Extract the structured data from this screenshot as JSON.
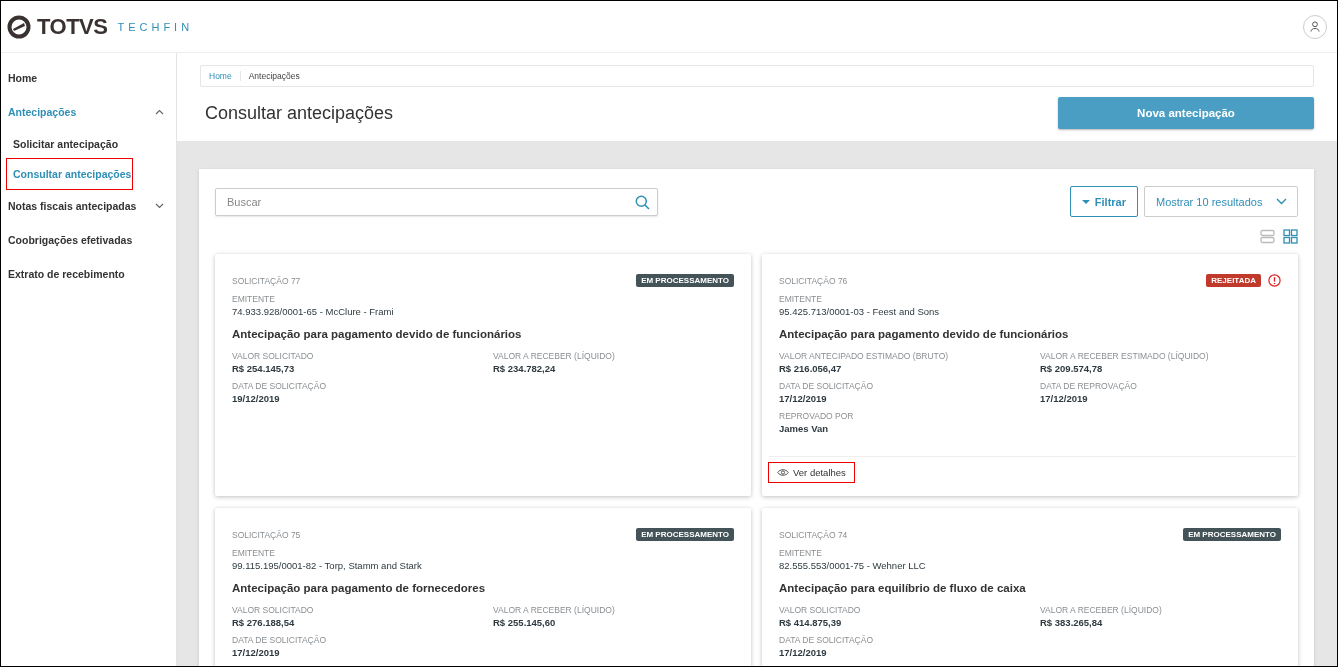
{
  "header": {
    "brand": "TOTVS",
    "brand_sub": "TECHFIN"
  },
  "sidebar": {
    "items": [
      {
        "label": "Home",
        "selected": false
      },
      {
        "label": "Antecipações",
        "selected": true,
        "expanded": true,
        "children": [
          {
            "label": "Solicitar antecipação",
            "selected": false,
            "highlighted": false
          },
          {
            "label": "Consultar antecipações",
            "selected": true,
            "highlighted": true
          }
        ]
      },
      {
        "label": "Notas fiscais antecipadas",
        "selected": false,
        "expanded": false
      },
      {
        "label": "Coobrigações efetivadas",
        "selected": false
      },
      {
        "label": "Extrato de recebimento",
        "selected": false
      }
    ]
  },
  "breadcrumb": [
    {
      "label": "Home",
      "kind": "link"
    },
    {
      "label": "Antecipações",
      "kind": "current"
    }
  ],
  "page_title": "Consultar antecipações",
  "primary_button": "Nova antecipação",
  "search": {
    "placeholder": "Buscar"
  },
  "filter_button": "Filtrar",
  "results_select": "Mostrar 10 resultados",
  "view_modes": [
    {
      "kind": "list",
      "selected": false
    },
    {
      "kind": "grid",
      "selected": true
    }
  ],
  "cards": [
    {
      "title": "SOLICITAÇÃO 77",
      "status": "EM PROCESSAMENTO",
      "kind": "processing",
      "issuer_label": "EMITENTE",
      "issuer": "74.933.928/0001-65 - McClure - Frami",
      "purpose": "Antecipação para pagamento devido de funcionários",
      "fields": [
        {
          "label": "VALOR SOLICITADO",
          "value": "R$ 254.145,73"
        },
        {
          "label": "VALOR A RECEBER (LÍQUIDO)",
          "value": "R$ 234.782,24"
        },
        {
          "label": "DATA DE SOLICITAÇÃO",
          "value": "19/12/2019"
        }
      ]
    },
    {
      "title": "SOLICITAÇÃO 76",
      "status": "REJEITADA",
      "kind": "rejected",
      "issuer_label": "EMITENTE",
      "issuer": "95.425.713/0001-03 - Feest and Sons",
      "purpose": "Antecipação para pagamento devido de funcionários",
      "fields": [
        {
          "label": "VALOR ANTECIPADO ESTIMADO (BRUTO)",
          "value": "R$ 216.056,47"
        },
        {
          "label": "VALOR A RECEBER ESTIMADO (LÍQUIDO)",
          "value": "R$ 209.574,78"
        },
        {
          "label": "DATA DE SOLICITAÇÃO",
          "value": "17/12/2019"
        },
        {
          "label": "DATA DE REPROVAÇÃO",
          "value": "17/12/2019"
        },
        {
          "label": "REPROVADO POR",
          "value": "James Van"
        }
      ],
      "details_link": {
        "label": "Ver detalhes",
        "highlighted": true
      }
    },
    {
      "title": "SOLICITAÇÃO 75",
      "status": "EM PROCESSAMENTO",
      "kind": "processing",
      "issuer_label": "EMITENTE",
      "issuer": "99.115.195/0001-82 - Torp, Stamm and Stark",
      "purpose": "Antecipação para pagamento de fornecedores",
      "fields": [
        {
          "label": "VALOR SOLICITADO",
          "value": "R$ 276.188,54"
        },
        {
          "label": "VALOR A RECEBER (LÍQUIDO)",
          "value": "R$ 255.145,60"
        },
        {
          "label": "DATA DE SOLICITAÇÃO",
          "value": "17/12/2019"
        }
      ]
    },
    {
      "title": "SOLICITAÇÃO 74",
      "status": "EM PROCESSAMENTO",
      "kind": "processing",
      "issuer_label": "EMITENTE",
      "issuer": "82.555.553/0001-75 - Wehner LLC",
      "purpose": "Antecipação para equilíbrio de fluxo de caixa",
      "fields": [
        {
          "label": "VALOR SOLICITADO",
          "value": "R$ 414.875,39"
        },
        {
          "label": "VALOR A RECEBER (LÍQUIDO)",
          "value": "R$ 383.265,84"
        },
        {
          "label": "DATA DE SOLICITAÇÃO",
          "value": "17/12/2019"
        }
      ]
    }
  ]
}
